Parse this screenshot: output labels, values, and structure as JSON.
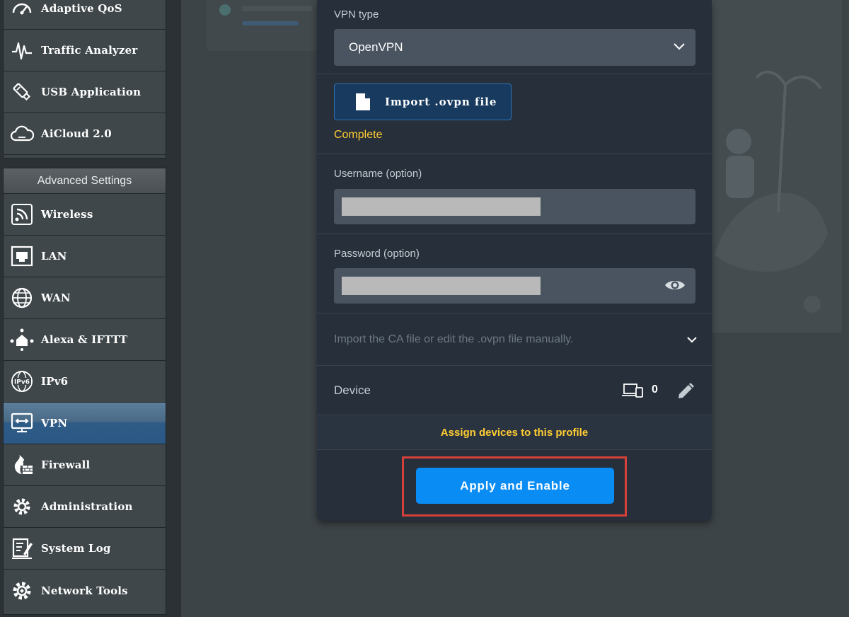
{
  "sidebar": {
    "top_items": [
      {
        "label": "Adaptive QoS",
        "icon": "speedometer-icon"
      },
      {
        "label": "Traffic Analyzer",
        "icon": "waveform-icon"
      },
      {
        "label": "USB Application",
        "icon": "usb-icon"
      },
      {
        "label": "AiCloud 2.0",
        "icon": "cloud-icon"
      }
    ],
    "advanced_header": "Advanced Settings",
    "advanced_items": [
      {
        "label": "Wireless",
        "icon": "wifi-icon"
      },
      {
        "label": "LAN",
        "icon": "lan-port-icon"
      },
      {
        "label": "WAN",
        "icon": "globe-icon"
      },
      {
        "label": "Alexa & IFTTT",
        "icon": "smart-home-icon"
      },
      {
        "label": "IPv6",
        "icon": "ipv6-globe-icon"
      },
      {
        "label": "VPN",
        "icon": "vpn-monitor-icon",
        "active": true
      },
      {
        "label": "Firewall",
        "icon": "firewall-icon"
      },
      {
        "label": "Administration",
        "icon": "admin-gear-icon"
      },
      {
        "label": "System Log",
        "icon": "log-icon"
      },
      {
        "label": "Network Tools",
        "icon": "tools-gear-icon"
      }
    ]
  },
  "vpn_form": {
    "vpn_type_label": "VPN type",
    "vpn_type_value": "OpenVPN",
    "import_button_label": "Import .ovpn file",
    "import_status": "Complete",
    "username_label": "Username (option)",
    "password_label": "Password (option)",
    "advanced_toggle_text": "Import the CA file or edit the .ovpn file manually.",
    "device_label": "Device",
    "device_count": "0",
    "assign_link": "Assign devices to this profile",
    "apply_button_label": "Apply and Enable"
  },
  "colors": {
    "accent_blue": "#0a8cf5",
    "status_yellow": "#ffcc33",
    "highlight_red": "#d6403a",
    "panel_bg": "#262f3a"
  }
}
